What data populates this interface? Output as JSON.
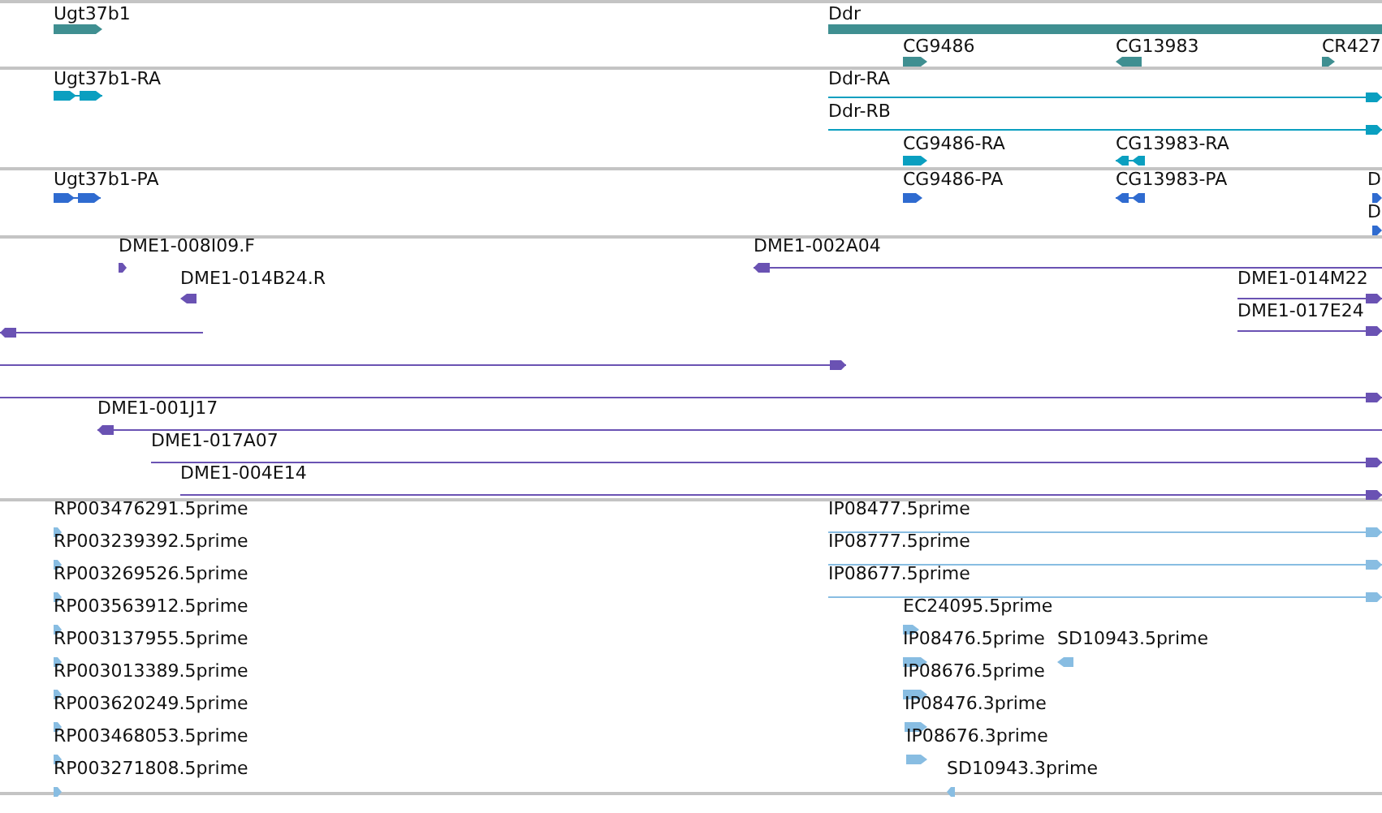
{
  "tracks": [
    {
      "color": "#3f8f91",
      "features": [
        {
          "label": "Ugt37b1",
          "kind": "block",
          "reverse": false
        },
        {
          "label": "Ddr",
          "kind": "bar"
        },
        {
          "label": "CG9486",
          "kind": "block",
          "reverse": false
        },
        {
          "label": "CG13983",
          "kind": "block",
          "reverse": true
        },
        {
          "label": "CR427",
          "kind": "block",
          "reverse": false
        }
      ]
    },
    {
      "color": "#0a9fc0",
      "features": [
        {
          "label": "Ugt37b1-RA",
          "kind": "exons",
          "reverse": false
        },
        {
          "label": "Ddr-RA",
          "kind": "line",
          "reverse": false
        },
        {
          "label": "Ddr-RB",
          "kind": "line",
          "reverse": false
        },
        {
          "label": "CG9486-RA",
          "kind": "block",
          "reverse": false
        },
        {
          "label": "CG13983-RA",
          "kind": "exons",
          "reverse": true
        }
      ]
    },
    {
      "color": "#2f6bd0",
      "features": [
        {
          "label": "Ugt37b1-PA",
          "kind": "exons",
          "reverse": false
        },
        {
          "label": "CG9486-PA",
          "kind": "block",
          "reverse": false
        },
        {
          "label": "CG13983-PA",
          "kind": "exons",
          "reverse": true
        },
        {
          "label": "D",
          "kind": "block",
          "reverse": false
        },
        {
          "label": "D",
          "kind": "block",
          "reverse": false
        }
      ]
    },
    {
      "color": "#6a52b3",
      "features": [
        {
          "label": "DME1-008I09.F",
          "kind": "block",
          "reverse": false
        },
        {
          "label": "DME1-002A04",
          "kind": "line",
          "reverse": true
        },
        {
          "label": "DME1-014B24.R",
          "kind": "block",
          "reverse": true
        },
        {
          "label": "DME1-014M22",
          "kind": "line",
          "reverse": false
        },
        {
          "label": "DME1-017E24",
          "kind": "line",
          "reverse": false
        },
        {
          "kind": "line",
          "reverse": true
        },
        {
          "kind": "line",
          "reverse": false
        },
        {
          "kind": "line",
          "reverse": false
        },
        {
          "label": "DME1-001J17",
          "kind": "line",
          "reverse": true
        },
        {
          "label": "DME1-017A07",
          "kind": "line",
          "reverse": false
        },
        {
          "label": "DME1-004E14",
          "kind": "line",
          "reverse": false
        }
      ]
    },
    {
      "color": "#88bde2",
      "features": [
        {
          "label": "RP003476291.5prime",
          "kind": "block",
          "reverse": false
        },
        {
          "label": "RP003239392.5prime",
          "kind": "block",
          "reverse": false
        },
        {
          "label": "RP003269526.5prime",
          "kind": "block",
          "reverse": false
        },
        {
          "label": "RP003563912.5prime",
          "kind": "block",
          "reverse": false
        },
        {
          "label": "RP003137955.5prime",
          "kind": "block",
          "reverse": false
        },
        {
          "label": "RP003013389.5prime",
          "kind": "block",
          "reverse": false
        },
        {
          "label": "RP003620249.5prime",
          "kind": "block",
          "reverse": false
        },
        {
          "label": "RP003468053.5prime",
          "kind": "block",
          "reverse": false
        },
        {
          "label": "RP003271808.5prime",
          "kind": "block",
          "reverse": false
        },
        {
          "label": "IP08477.5prime",
          "kind": "line",
          "reverse": false
        },
        {
          "label": "IP08777.5prime",
          "kind": "line",
          "reverse": false
        },
        {
          "label": "IP08677.5prime",
          "kind": "line",
          "reverse": false
        },
        {
          "label": "EC24095.5prime",
          "kind": "block",
          "reverse": false
        },
        {
          "label": "IP08476.5prime",
          "kind": "block",
          "reverse": false
        },
        {
          "label": "SD10943.5prime",
          "kind": "block",
          "reverse": true
        },
        {
          "label": "IP08676.5prime",
          "kind": "block",
          "reverse": false
        },
        {
          "label": "IP08476.3prime",
          "kind": "block",
          "reverse": false
        },
        {
          "label": "IP08676.3prime",
          "kind": "block",
          "reverse": false
        },
        {
          "label": "SD10943.3prime",
          "kind": "block",
          "reverse": true
        }
      ]
    }
  ]
}
